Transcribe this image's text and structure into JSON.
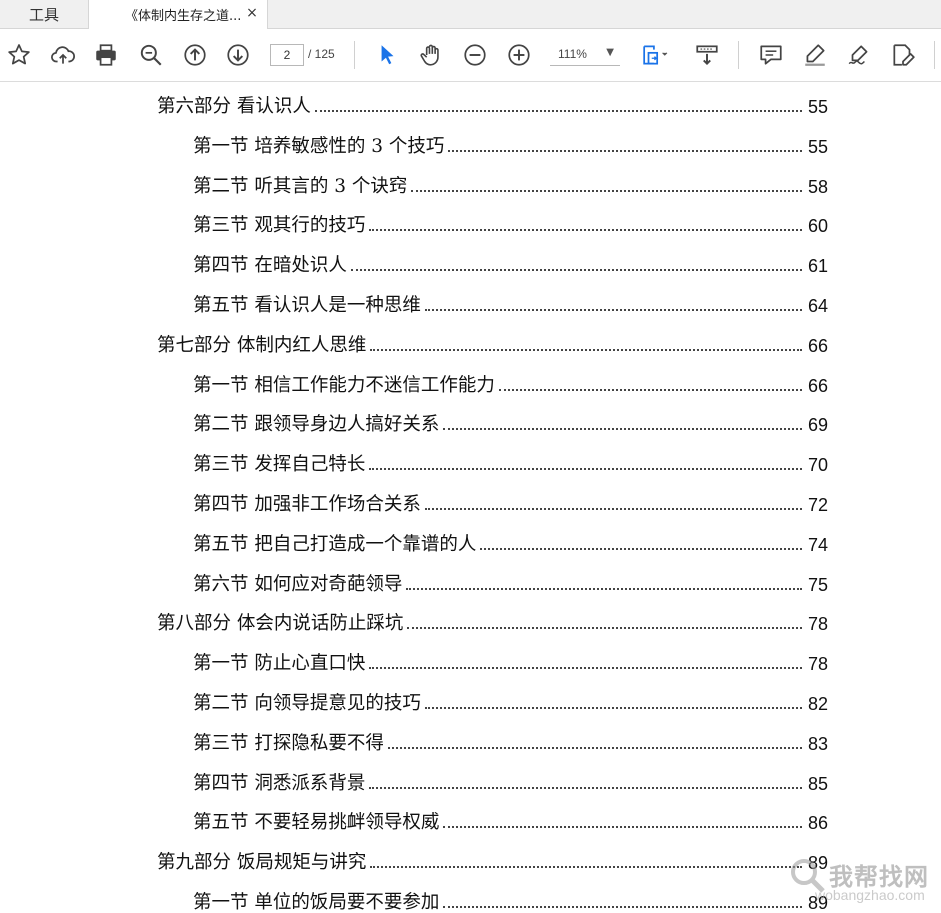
{
  "tabs": {
    "tools_label": "工具",
    "document_title": "《体制内生存之道...",
    "close_glyph": "×"
  },
  "toolbar": {
    "icons": [
      "star-icon",
      "upload-icon",
      "print-icon",
      "zoom-out-search-icon",
      "page-up-icon",
      "page-down-icon",
      "select-cursor-icon",
      "hand-tool-icon",
      "minus-circle-icon",
      "plus-circle-icon",
      "fit-page-icon",
      "scroll-mode-icon",
      "comment-icon",
      "highlight-icon",
      "sign-icon",
      "edit-pdf-icon"
    ],
    "current_page": "2",
    "page_total": "/ 125",
    "zoom": "111%",
    "accent_color": "#1a73e8"
  },
  "toc": [
    {
      "label": "第六部分  看认识人",
      "page": "55",
      "level": 1
    },
    {
      "label": "第一节  培养敏感性的 3 个技巧",
      "page": "55",
      "level": 2
    },
    {
      "label": "第二节  听其言的 3 个诀窍",
      "page": "58",
      "level": 2
    },
    {
      "label": "第三节  观其行的技巧",
      "page": "60",
      "level": 2
    },
    {
      "label": "第四节  在暗处识人",
      "page": "61",
      "level": 2
    },
    {
      "label": "第五节  看认识人是一种思维",
      "page": "64",
      "level": 2
    },
    {
      "label": "第七部分  体制内红人思维",
      "page": "66",
      "level": 1
    },
    {
      "label": "第一节  相信工作能力不迷信工作能力",
      "page": "66",
      "level": 2
    },
    {
      "label": "第二节  跟领导身边人搞好关系",
      "page": "69",
      "level": 2
    },
    {
      "label": "第三节  发挥自己特长",
      "page": "70",
      "level": 2
    },
    {
      "label": "第四节  加强非工作场合关系",
      "page": "72",
      "level": 2
    },
    {
      "label": "第五节  把自己打造成一个靠谱的人",
      "page": "74",
      "level": 2
    },
    {
      "label": "第六节  如何应对奇葩领导",
      "page": "75",
      "level": 2
    },
    {
      "label": "第八部分  体会内说话防止踩坑",
      "page": "78",
      "level": 1
    },
    {
      "label": "第一节  防止心直口快",
      "page": "78",
      "level": 2
    },
    {
      "label": "第二节  向领导提意见的技巧",
      "page": "82",
      "level": 2
    },
    {
      "label": "第三节  打探隐私要不得",
      "page": "83",
      "level": 2
    },
    {
      "label": "第四节  洞悉派系背景",
      "page": "85",
      "level": 2
    },
    {
      "label": "第五节  不要轻易挑衅领导权威",
      "page": "86",
      "level": 2
    },
    {
      "label": "第九部分  饭局规矩与讲究",
      "page": "89",
      "level": 1
    },
    {
      "label": "第一节  单位的饭局要不要参加",
      "page": "89",
      "level": 2
    }
  ],
  "watermark": {
    "text": "我帮找网",
    "url": "wobangzhao.com"
  }
}
